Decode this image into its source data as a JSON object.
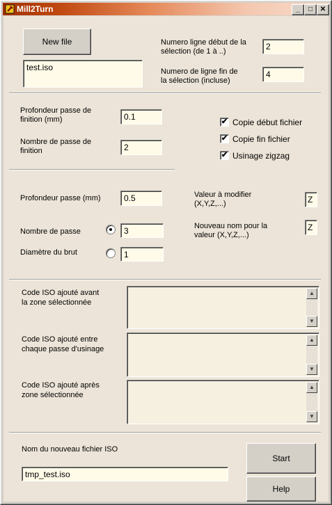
{
  "window": {
    "title": "Mill2Turn",
    "minimize": "_",
    "maximize": "□",
    "close": "✕"
  },
  "file": {
    "new_file_label": "New file",
    "filename_value": "test.iso"
  },
  "selection": {
    "start_label_1": "Numero ligne début de la",
    "start_label_2": "sélection (de 1 à ..)",
    "start_value": "2",
    "end_label_1": "Numero de ligne fin de",
    "end_label_2": "la sélection (incluse)",
    "end_value": "4"
  },
  "finishing": {
    "depth_label_1": "Profondeur passe de",
    "depth_label_2": "finition (mm)",
    "depth_value": "0.1",
    "count_label_1": "Nombre de passe de",
    "count_label_2": "finition",
    "count_value": "2"
  },
  "options": {
    "copy_start_label": "Copie début fichier",
    "copy_start_checked": "✔",
    "copy_end_label": "Copie fin fichier",
    "copy_end_checked": "✔",
    "zigzag_label": "Usinage zigzag",
    "zigzag_checked": "✔"
  },
  "passes": {
    "depth_label": "Profondeur passe (mm)",
    "depth_value": "0.5",
    "count_label": "Nombre de passe",
    "count_value": "3",
    "diameter_label": "Diamètre du brut",
    "diameter_value": "1"
  },
  "axis": {
    "value_label_1": "Valeur à modifier",
    "value_label_2": "(X,Y,Z,...)",
    "value_value": "Z",
    "newname_label_1": "Nouveau nom pour la",
    "newname_label_2": "valeur (X,Y,Z,...)",
    "newname_value": "Z"
  },
  "iso_code": {
    "before_label_1": "Code ISO ajouté avant",
    "before_label_2": "la zone sélectionnée",
    "between_label_1": "Code ISO ajouté entre",
    "between_label_2": "chaque passe d'usinage",
    "after_label_1": "Code ISO ajouté après",
    "after_label_2": "zone sélectionnée"
  },
  "output": {
    "filename_label": "Nom du nouveau fichier ISO",
    "filename_value": "tmp_test.iso",
    "start_label": "Start",
    "help_label": "Help"
  }
}
